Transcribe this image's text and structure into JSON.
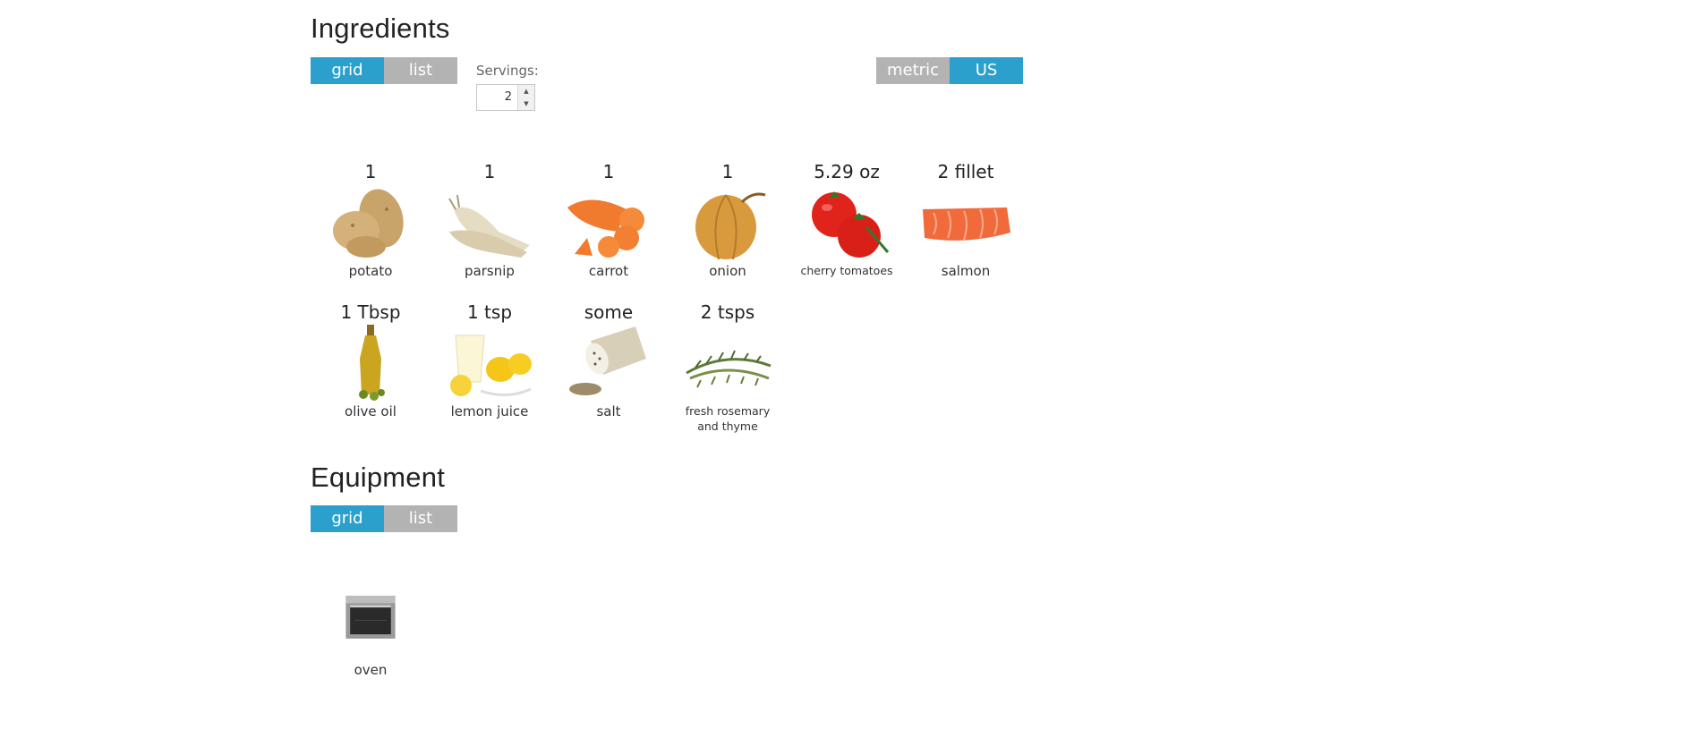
{
  "ingredients": {
    "title": "Ingredients",
    "view_toggle": {
      "grid": "grid",
      "list": "list",
      "selected": "grid"
    },
    "unit_toggle": {
      "metric": "metric",
      "us": "US",
      "selected": "US"
    },
    "servings": {
      "label": "Servings:",
      "value": "2",
      "up_icon": "triangle-up-icon",
      "down_icon": "triangle-down-icon"
    },
    "items": [
      {
        "qty": "1",
        "name": "potato",
        "icon": "potato-icon"
      },
      {
        "qty": "1",
        "name": "parsnip",
        "icon": "parsnip-icon"
      },
      {
        "qty": "1",
        "name": "carrot",
        "icon": "carrot-icon"
      },
      {
        "qty": "1",
        "name": "onion",
        "icon": "onion-icon"
      },
      {
        "qty": "5.29 oz",
        "name": "cherry tomatoes",
        "icon": "cherry-tomatoes-icon"
      },
      {
        "qty": "2 fillet",
        "name": "salmon",
        "icon": "salmon-icon"
      },
      {
        "qty": "1 Tbsp",
        "name": "olive oil",
        "icon": "olive-oil-icon"
      },
      {
        "qty": "1 tsp",
        "name": "lemon juice",
        "icon": "lemon-juice-icon"
      },
      {
        "qty": "some",
        "name": "salt",
        "icon": "salt-icon"
      },
      {
        "qty": "2 tsps",
        "name": "fresh rosemary and thyme",
        "icon": "rosemary-thyme-icon"
      }
    ]
  },
  "equipment": {
    "title": "Equipment",
    "view_toggle": {
      "grid": "grid",
      "list": "list",
      "selected": "grid"
    },
    "items": [
      {
        "name": "oven",
        "icon": "oven-icon"
      }
    ]
  },
  "colors": {
    "active": "#2ba0cd",
    "inactive": "#b3b3b3"
  }
}
